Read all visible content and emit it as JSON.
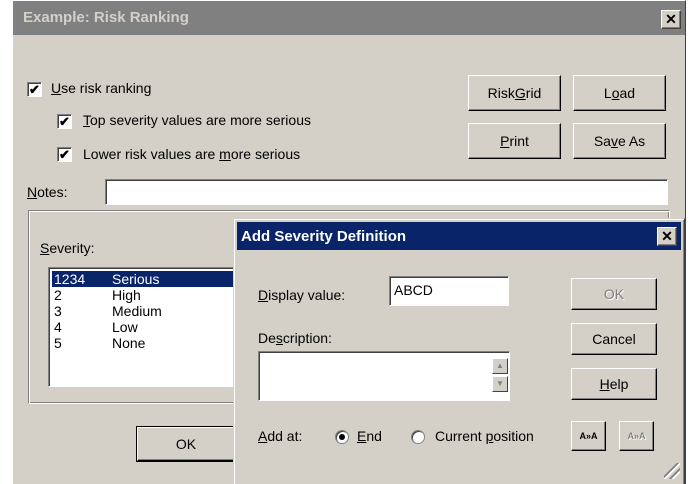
{
  "main_dialog": {
    "title": "Example: Risk Ranking",
    "close_glyph": "✕",
    "use_risk_ranking": {
      "label_u": "U",
      "label_rest": "se risk ranking",
      "checked": true
    },
    "top_severity": {
      "label_u": "T",
      "label_rest": "op severity values are more serious",
      "checked": true
    },
    "lower_risk": {
      "label_pre": "Lower risk values are ",
      "label_u": "m",
      "label_rest": "ore serious",
      "checked": true
    },
    "buttons": {
      "risk_grid": {
        "pre": "Risk ",
        "u": "G",
        "post": "rid"
      },
      "load": {
        "pre": "L",
        "u": "o",
        "post": "ad"
      },
      "print": {
        "pre": "",
        "u": "P",
        "post": "rint"
      },
      "save_as": {
        "pre": "Sa",
        "u": "v",
        "post": "e As"
      },
      "ok": "OK"
    },
    "notes": {
      "label_u": "N",
      "label_rest": "otes:",
      "value": ""
    },
    "severity": {
      "label_u": "S",
      "label_rest": "everity:",
      "items": [
        {
          "value": "1234",
          "desc": "Serious",
          "selected": true
        },
        {
          "value": "2",
          "desc": "High",
          "selected": false
        },
        {
          "value": "3",
          "desc": "Medium",
          "selected": false
        },
        {
          "value": "4",
          "desc": "Low",
          "selected": false
        },
        {
          "value": "5",
          "desc": "None",
          "selected": false
        }
      ]
    }
  },
  "popup": {
    "title": "Add Severity Definition",
    "close_glyph": "✕",
    "display_value": {
      "label_u": "D",
      "label_rest": "isplay value:",
      "value": "ABCD"
    },
    "description": {
      "label_pre": "De",
      "label_u": "s",
      "label_rest": "cription:",
      "value": ""
    },
    "buttons": {
      "ok": "OK",
      "cancel": "Cancel",
      "help": {
        "u": "H",
        "post": "elp"
      },
      "font_a": "A»A",
      "font_b": "A»A"
    },
    "add_at": {
      "label_u": "A",
      "label_rest": "dd at:",
      "options": [
        {
          "pre": "",
          "u": "E",
          "post": "nd",
          "selected": true
        },
        {
          "pre": "Current ",
          "u": "p",
          "post": "osition",
          "selected": false
        }
      ]
    },
    "scroll_up_icon": "▲",
    "scroll_down_icon": "▼"
  },
  "colors": {
    "face": "#d4d0c8",
    "active_title": "#0a246a",
    "inactive_title": "#808080",
    "selection": "#0a246a"
  }
}
